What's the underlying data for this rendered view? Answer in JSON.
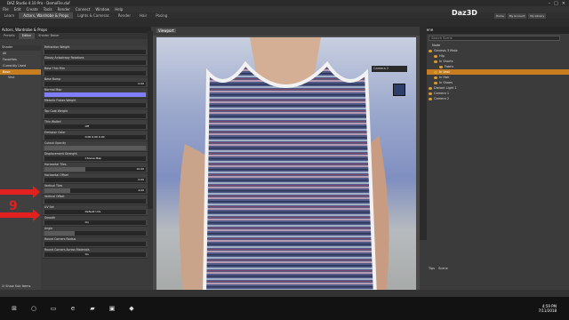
{
  "window": {
    "title": "DAZ Studio 4.10 Pro - DemoFile.duf"
  },
  "menubar": [
    "File",
    "Edit",
    "Create",
    "Tools",
    "Render",
    "Connect",
    "Window",
    "Help"
  ],
  "tabs": [
    "Learn",
    "Actors, Wardrobe & Props",
    "Lights & Cameras",
    "Render",
    "Hair",
    "Posing"
  ],
  "brand": {
    "logo": "Daz3D",
    "links": [
      "Home",
      "My Account",
      "My Library"
    ]
  },
  "left": {
    "pane_title": "Actors, Wardrobe & Props",
    "subtabs": [
      "Presets",
      "Editor",
      "Shader Baker"
    ],
    "list_head": "Shader",
    "list_items": [
      "All",
      "Favorites",
      "Currently Used"
    ],
    "nodes": [
      "Base",
      "Vest"
    ],
    "properties": [
      {
        "label": "Refraction Weight",
        "kind": "slider",
        "fraction": 0.0
      },
      {
        "label": "Glossy Anisotropy Rotations",
        "kind": "slider",
        "fraction": 0.0
      },
      {
        "label": "Base Thin Film",
        "kind": "slider",
        "fraction": 0.0
      },
      {
        "label": "Base Bump",
        "kind": "slider",
        "value": "0.00",
        "fraction": 0.0
      },
      {
        "label": "Normal Map",
        "kind": "swatch",
        "color": "#7f7fff"
      },
      {
        "label": "Metallic Flakes Weight",
        "kind": "slider",
        "fraction": 0.0
      },
      {
        "label": "Top Coat Weight",
        "kind": "slider",
        "fraction": 0.0
      },
      {
        "label": "Thin Walled",
        "kind": "button",
        "value": "Off"
      },
      {
        "label": "Emission Color",
        "kind": "rgb",
        "value": "0.00   0.00   0.00"
      },
      {
        "label": "Cutout Opacity",
        "kind": "slider",
        "fraction": 1.0
      },
      {
        "label": "Displacement Strength",
        "kind": "button",
        "value": "Choose Map"
      },
      {
        "label": "Horizontal Tiles",
        "kind": "slider",
        "value": "10.00",
        "fraction": 0.4
      },
      {
        "label": "Horizontal Offset",
        "kind": "slider",
        "value": "0.00",
        "fraction": 0.0
      },
      {
        "label": "Vertical Tiles",
        "kind": "slider",
        "value": "4.00",
        "fraction": 0.25
      },
      {
        "label": "Vertical Offset",
        "kind": "slider",
        "fraction": 0.0
      },
      {
        "label": "UV Set",
        "kind": "select",
        "value": "Default UVs"
      },
      {
        "label": "Smooth",
        "kind": "button",
        "value": "On"
      },
      {
        "label": "Angle",
        "kind": "slider",
        "fraction": 0.3
      },
      {
        "label": "Round Corners Radius",
        "kind": "slider",
        "fraction": 0.0
      },
      {
        "label": "Round Corners Across Materials",
        "kind": "button",
        "value": "On"
      }
    ],
    "show_sub_items": "Show Sub Items"
  },
  "annotation": {
    "number": "9",
    "color": "#e32020"
  },
  "viewport": {
    "label": "Viewport",
    "camera": "Camera 2"
  },
  "scene": {
    "title": "Scene",
    "search_placeholder": "Search Scene",
    "header": "Node",
    "rows": [
      {
        "label": "Genesis 3 Male",
        "selected": false
      },
      {
        "label": "Hip",
        "selected": false
      },
      {
        "label": "In Shorts",
        "selected": false
      },
      {
        "label": "Fabric",
        "selected": false
      },
      {
        "label": "In Vest",
        "selected": true
      },
      {
        "label": "In Hair",
        "selected": false
      },
      {
        "label": "In Shoes",
        "selected": false
      },
      {
        "label": "Distant Light 1",
        "selected": false
      },
      {
        "label": "Camera 1",
        "selected": false
      },
      {
        "label": "Camera 2",
        "selected": false
      }
    ],
    "bottom_tabs": [
      "Tips",
      "Scene"
    ],
    "lesson": "Select a Lesson"
  },
  "taskbar": {
    "time": "4:59 PM",
    "date": "7/11/2018"
  }
}
